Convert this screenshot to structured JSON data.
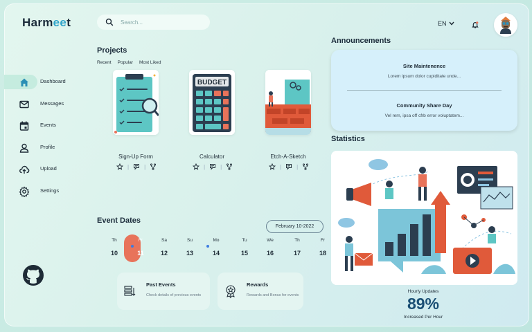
{
  "app": {
    "logo_main": "Harm",
    "logo_accent": "ee",
    "logo_tail": "t"
  },
  "sidebar": {
    "items": [
      {
        "label": "Dashboard",
        "icon": "home-icon",
        "active": true
      },
      {
        "label": "Messages",
        "icon": "mail-icon"
      },
      {
        "label": "Events",
        "icon": "calendar-icon"
      },
      {
        "label": "Profile",
        "icon": "user-icon"
      },
      {
        "label": "Upload",
        "icon": "cloud-upload-icon"
      },
      {
        "label": "Settings",
        "icon": "gear-icon"
      }
    ],
    "footer_icon": "github-icon"
  },
  "search": {
    "placeholder": "Search...",
    "value": ""
  },
  "header": {
    "language": "EN",
    "notification_icon": "bell-icon",
    "avatar": "avatar"
  },
  "projects": {
    "title": "Projects",
    "filters": [
      "Recent",
      "Popular",
      "Most Liked"
    ],
    "cards": [
      {
        "title": "Sign-Up Form",
        "image": "signup-form-illustration"
      },
      {
        "title": "Calculator",
        "image": "calculator-illustration",
        "badge": "BUDGET"
      },
      {
        "title": "Etch-A-Sketch",
        "image": "etch-a-sketch-illustration"
      }
    ],
    "action_icons": [
      "star-icon",
      "comment-icon",
      "fork-icon"
    ]
  },
  "events": {
    "title": "Event Dates",
    "selected_date": "February 10-2022",
    "days": [
      {
        "name": "Th",
        "date": "10"
      },
      {
        "name": "Fr",
        "date": "11",
        "active": true,
        "dot": true
      },
      {
        "name": "Sa",
        "date": "12"
      },
      {
        "name": "Su",
        "date": "13"
      },
      {
        "name": "Mo",
        "date": "14",
        "dot": true
      },
      {
        "name": "Tu",
        "date": "15"
      },
      {
        "name": "We",
        "date": "16"
      },
      {
        "name": "Th",
        "date": "17"
      },
      {
        "name": "Fr",
        "date": "18"
      }
    ],
    "cards": [
      {
        "title": "Past Events",
        "desc": "Check details of previous events",
        "icon": "stack-icon"
      },
      {
        "title": "Rewards",
        "desc": "Rewards and Bonus for events",
        "icon": "award-icon"
      }
    ]
  },
  "announcements": {
    "title": "Announcements",
    "items": [
      {
        "title": "Site Maintenence",
        "desc": "Lorem ipsum dolor cupiditate unde..."
      },
      {
        "title": "Community Share Day",
        "desc": "Vel rem, ipsa off cfrb error voluptatem..."
      }
    ]
  },
  "statistics": {
    "title": "Statistics",
    "image": "marketing-statistics-illustration",
    "hourly_label": "Hourly Updates",
    "value": "89%",
    "value_caption": "Increased Per Hour"
  },
  "colors": {
    "accent": "#2fa4c9",
    "active_day": "#e8735a",
    "active_nav": "#c5ecdf",
    "announcement_bg": "#d6f0fb"
  }
}
